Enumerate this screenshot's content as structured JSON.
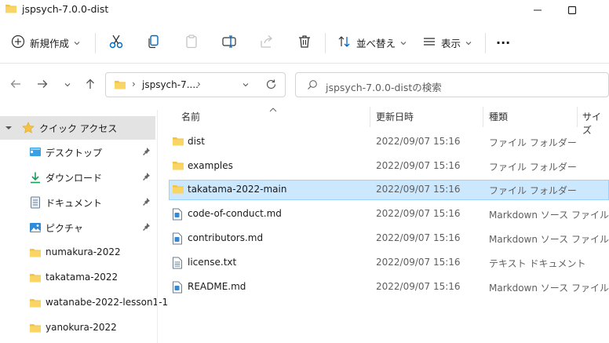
{
  "window": {
    "title": "jspsych-7.0.0-dist",
    "minimize": "–",
    "maximize": "☐"
  },
  "toolbar": {
    "new_label": "新規作成",
    "sort_label": "並べ替え",
    "view_label": "表示",
    "more_label": "···"
  },
  "nav": {
    "address_text": "jspsych-7....",
    "search_placeholder": "jspsych-7.0.0-distの検索"
  },
  "sidebar": {
    "quick_access": "クイック アクセス",
    "items": [
      {
        "label": "デスクトップ",
        "icon": "desktop-icon",
        "pinned": true
      },
      {
        "label": "ダウンロード",
        "icon": "download-icon",
        "pinned": true
      },
      {
        "label": "ドキュメント",
        "icon": "document-icon",
        "pinned": true
      },
      {
        "label": "ピクチャ",
        "icon": "picture-icon",
        "pinned": true
      },
      {
        "label": "numakura-2022",
        "icon": "folder-icon",
        "pinned": false
      },
      {
        "label": "takatama-2022",
        "icon": "folder-icon",
        "pinned": false
      },
      {
        "label": "watanabe-2022-lesson1-1",
        "icon": "folder-icon",
        "pinned": false
      },
      {
        "label": "yanokura-2022",
        "icon": "folder-icon",
        "pinned": false
      }
    ]
  },
  "columns": {
    "name": "名前",
    "date": "更新日時",
    "type": "種類",
    "size": "サイズ"
  },
  "files": [
    {
      "name": "dist",
      "date": "2022/09/07 15:16",
      "type": "ファイル フォルダー",
      "icon": "folder-icon",
      "selected": false
    },
    {
      "name": "examples",
      "date": "2022/09/07 15:16",
      "type": "ファイル フォルダー",
      "icon": "folder-icon",
      "selected": false
    },
    {
      "name": "takatama-2022-main",
      "date": "2022/09/07 15:16",
      "type": "ファイル フォルダー",
      "icon": "folder-icon",
      "selected": true
    },
    {
      "name": "code-of-conduct.md",
      "date": "2022/09/07 15:16",
      "type": "Markdown ソース ファイル",
      "icon": "markdown-file-icon",
      "selected": false
    },
    {
      "name": "contributors.md",
      "date": "2022/09/07 15:16",
      "type": "Markdown ソース ファイル",
      "icon": "markdown-file-icon",
      "selected": false
    },
    {
      "name": "license.txt",
      "date": "2022/09/07 15:16",
      "type": "テキスト ドキュメント",
      "icon": "text-file-icon",
      "selected": false
    },
    {
      "name": "README.md",
      "date": "2022/09/07 15:16",
      "type": "Markdown ソース ファイル",
      "icon": "markdown-file-icon",
      "selected": false
    }
  ],
  "colors": {
    "folder": "#f5c242",
    "selection": "#cce8ff",
    "accent": "#0067c0"
  }
}
